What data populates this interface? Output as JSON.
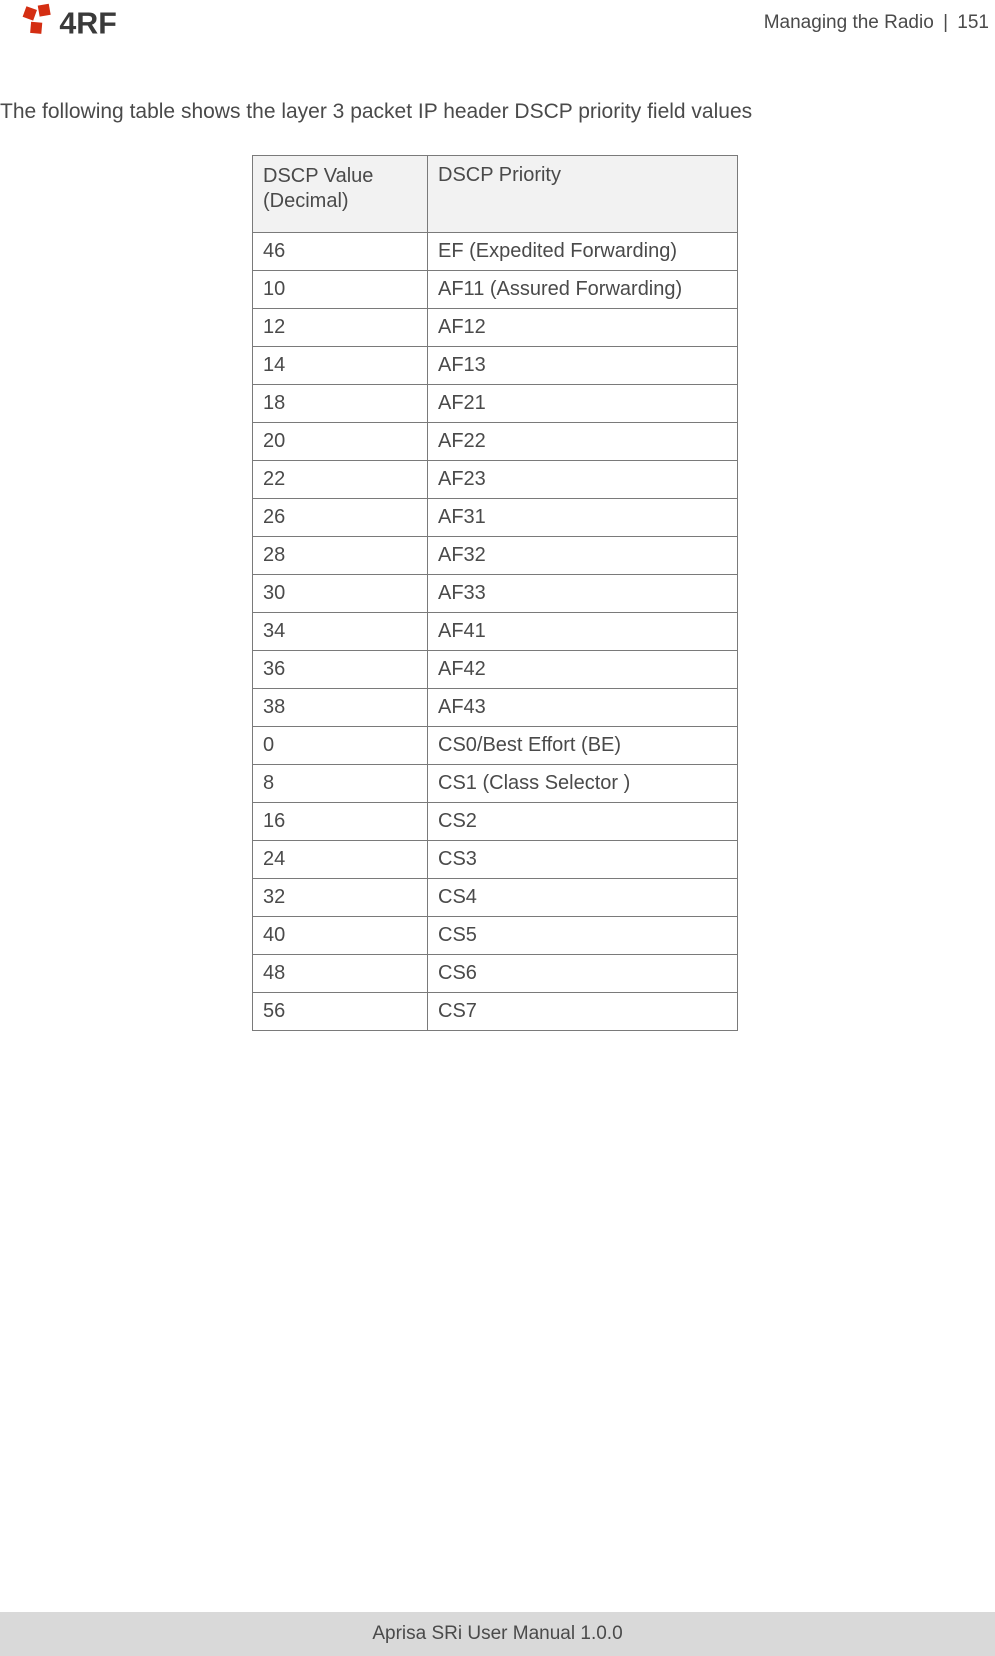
{
  "header": {
    "section": "Managing the Radio",
    "separator": "|",
    "page_number": "151"
  },
  "logo": {
    "text": "4RF"
  },
  "intro_text": "The following table shows the layer 3 packet IP header DSCP priority field values",
  "table": {
    "headers": {
      "col1_line1": "DSCP Value",
      "col1_line2": "(Decimal)",
      "col2": "DSCP Priority"
    },
    "rows": [
      {
        "value": "46",
        "priority": "EF (Expedited Forwarding)"
      },
      {
        "value": "10",
        "priority": "AF11 (Assured Forwarding)"
      },
      {
        "value": "12",
        "priority": "AF12"
      },
      {
        "value": "14",
        "priority": "AF13"
      },
      {
        "value": "18",
        "priority": "AF21"
      },
      {
        "value": "20",
        "priority": "AF22"
      },
      {
        "value": "22",
        "priority": "AF23"
      },
      {
        "value": "26",
        "priority": "AF31"
      },
      {
        "value": "28",
        "priority": "AF32"
      },
      {
        "value": "30",
        "priority": "AF33"
      },
      {
        "value": "34",
        "priority": "AF41"
      },
      {
        "value": "36",
        "priority": "AF42"
      },
      {
        "value": "38",
        "priority": "AF43"
      },
      {
        "value": "0",
        "priority": "CS0/Best Effort (BE)"
      },
      {
        "value": "8",
        "priority": "CS1 (Class Selector )"
      },
      {
        "value": "16",
        "priority": "CS2"
      },
      {
        "value": "24",
        "priority": "CS3"
      },
      {
        "value": "32",
        "priority": "CS4"
      },
      {
        "value": "40",
        "priority": "CS5"
      },
      {
        "value": "48",
        "priority": "CS6"
      },
      {
        "value": "56",
        "priority": "CS7"
      }
    ]
  },
  "footer": "Aprisa SRi User Manual 1.0.0"
}
